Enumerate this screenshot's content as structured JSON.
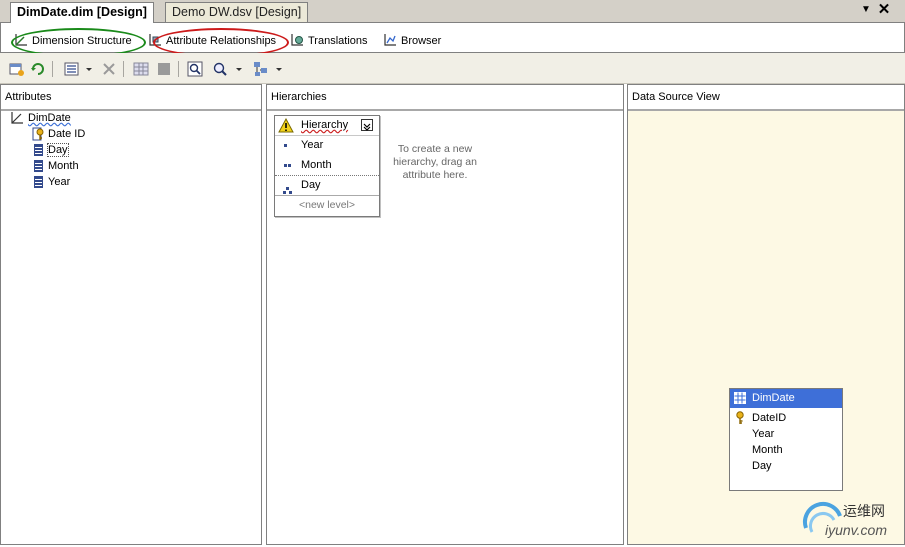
{
  "doc_tabs": {
    "active": "DimDate.dim [Design]",
    "inactive": "Demo DW.dsv [Design]",
    "pin_glyph": "▼",
    "close_glyph": "✕"
  },
  "designer_tabs": [
    {
      "label": "Dimension Structure",
      "icon": "dimension-structure-icon"
    },
    {
      "label": "Attribute Relationships",
      "icon": "attribute-relationships-icon"
    },
    {
      "label": "Translations",
      "icon": "translations-icon"
    },
    {
      "label": "Browser",
      "icon": "browser-icon"
    }
  ],
  "annotation_colors": {
    "green": "#1a8a1a",
    "red": "#cc1a1a"
  },
  "toolbar": {
    "icons": [
      "add-table-icon",
      "refresh-icon",
      "show-attributes-icon",
      "dropdown-arrow-icon",
      "delete-icon",
      "grid-icon",
      "stop-icon",
      "zoom-to-fit-icon",
      "zoom-icon",
      "dropdown-arrow-icon",
      "arrange-icon",
      "dropdown-arrow-icon"
    ]
  },
  "attributes_pane": {
    "title": "Attributes",
    "root": "DimDate",
    "items": [
      "Date ID",
      "Day",
      "Month",
      "Year"
    ]
  },
  "hierarchies_pane": {
    "title": "Hierarchies",
    "hierarchy": {
      "name": "Hierarchy",
      "levels": [
        "Year",
        "Month",
        "Day"
      ],
      "new_level": "<new level>"
    },
    "hint": "To create a new hierarchy, drag an attribute here."
  },
  "dsv_pane": {
    "title": "Data Source View",
    "table": {
      "name": "DimDate",
      "columns": [
        "DateID",
        "Year",
        "Month",
        "Day"
      ]
    }
  },
  "watermark": {
    "text": "运维网",
    "domain": "iyunv.com"
  },
  "colors": {
    "dsv_bg": "#fdf9e4",
    "table_header": "#3e6fd8"
  }
}
